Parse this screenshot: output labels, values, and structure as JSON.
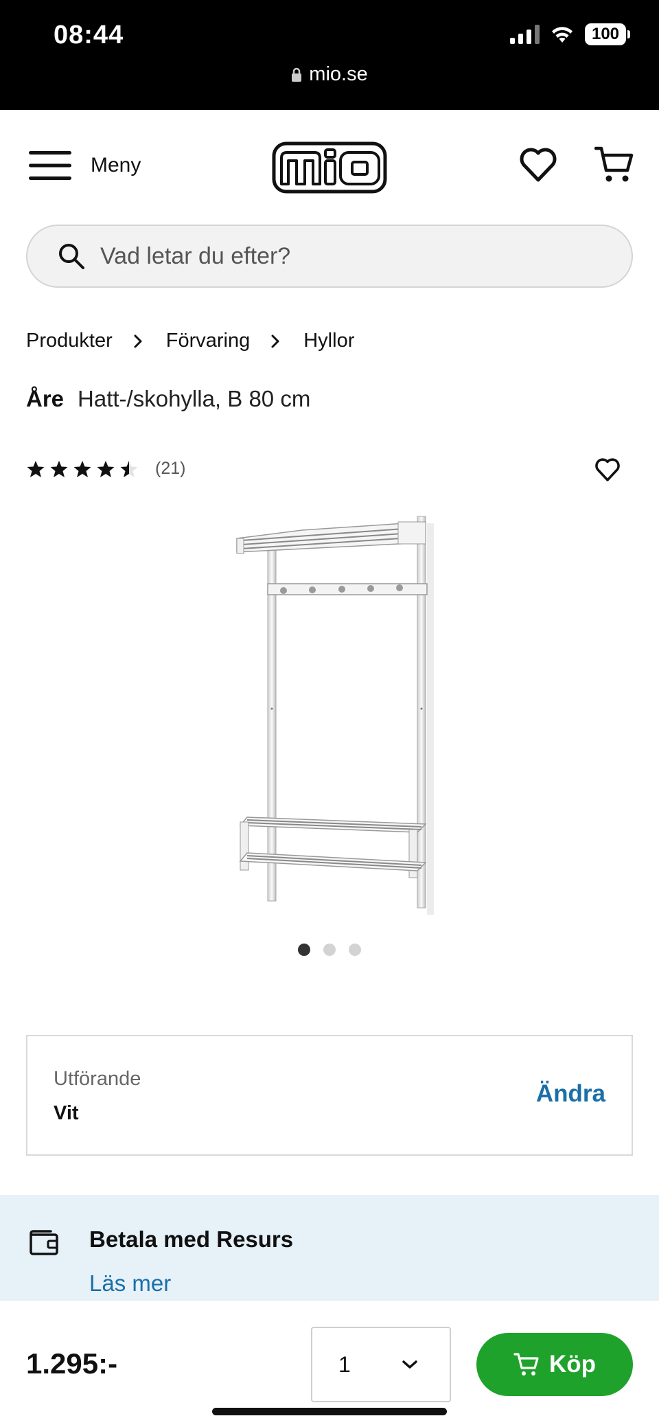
{
  "status_bar": {
    "time": "08:44",
    "battery": "100",
    "url": "mio.se"
  },
  "header": {
    "menu_label": "Meny",
    "logo_text": "mio"
  },
  "search": {
    "placeholder": "Vad letar du efter?"
  },
  "breadcrumb": [
    "Produkter",
    "Förvaring",
    "Hyllor"
  ],
  "product": {
    "brand": "Åre",
    "name": "Hatt-/skohylla, B 80 cm",
    "rating": 4.5,
    "rating_max": 5,
    "review_count": "(21)",
    "image_count": 3,
    "active_image": 1
  },
  "variant": {
    "label": "Utförande",
    "value": "Vit",
    "change_label": "Ändra"
  },
  "payment": {
    "title": "Betala med Resurs",
    "link": "Läs mer"
  },
  "purchase": {
    "price": "1.295:-",
    "quantity": "1",
    "buy_label": "Köp"
  },
  "colors": {
    "accent_blue": "#1a6fa8",
    "buy_green": "#1fa22b",
    "info_bg": "#e7f1f8"
  }
}
